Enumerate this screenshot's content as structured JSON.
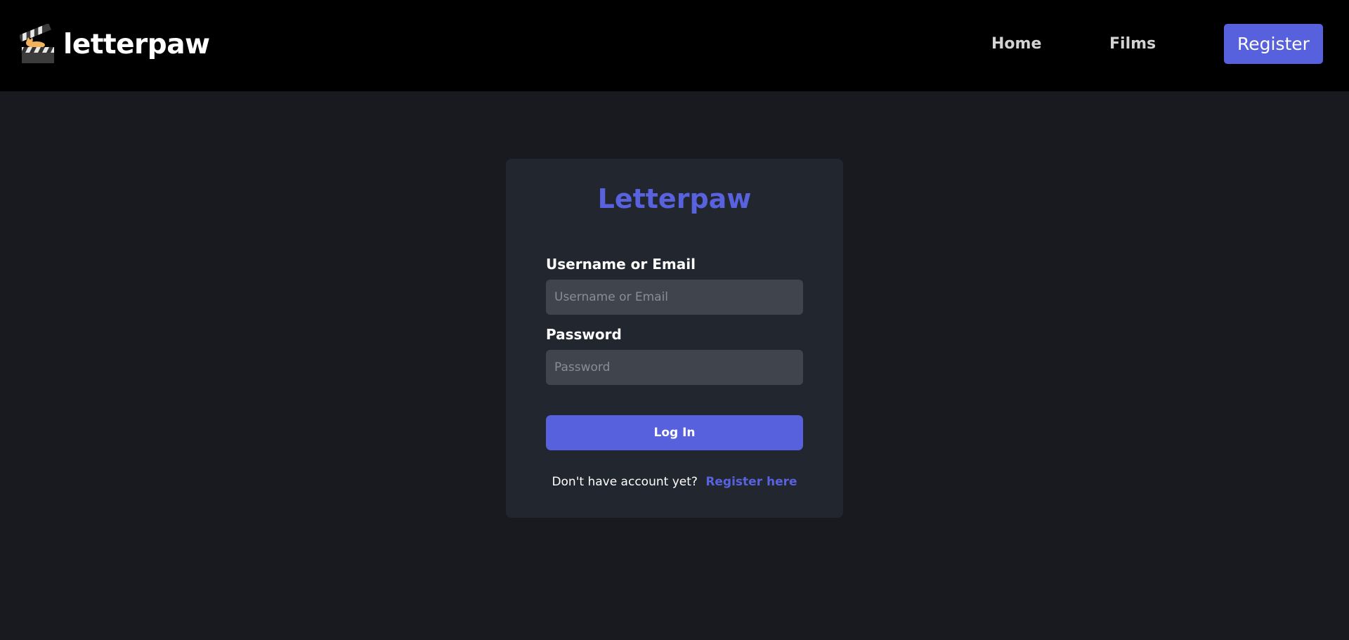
{
  "header": {
    "brand_name": "letterpaw",
    "logo_icon": "clapperboard-cat-icon",
    "nav": {
      "home": "Home",
      "films": "Films"
    },
    "register_label": "Register"
  },
  "login": {
    "title": "Letterpaw",
    "username_label": "Username or Email",
    "username_placeholder": "Username or Email",
    "username_value": "",
    "password_label": "Password",
    "password_placeholder": "Password",
    "password_value": "",
    "submit_label": "Log In",
    "footer_text": "Don't have account yet?",
    "footer_link": "Register here"
  },
  "colors": {
    "page_background": "#181a1f",
    "header_background": "#000000",
    "card_background": "#22262e",
    "accent": "#5861dd",
    "input_background": "#40444c"
  }
}
